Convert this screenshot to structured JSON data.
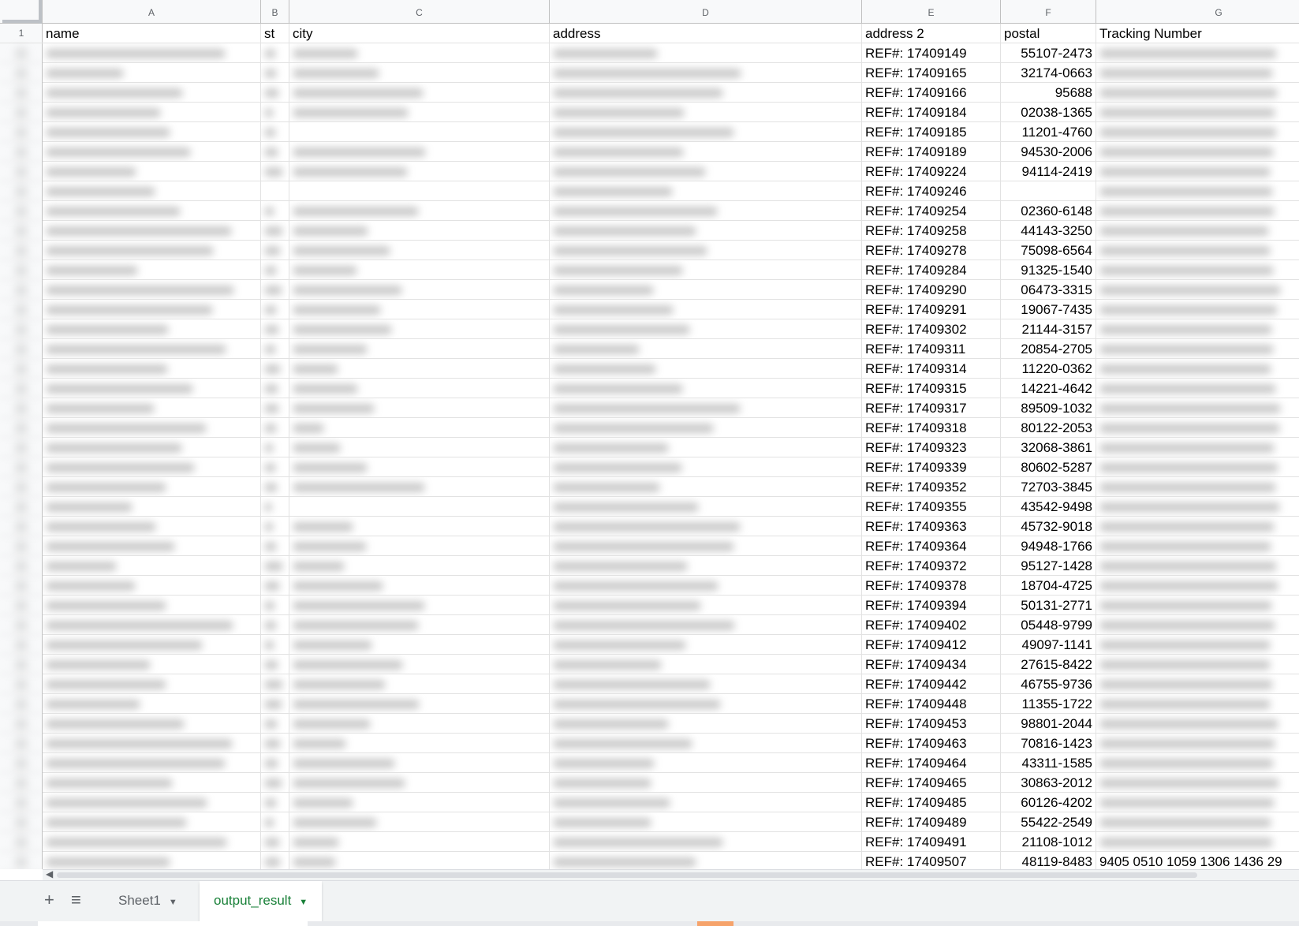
{
  "spreadsheet": {
    "column_letters": [
      "A",
      "B",
      "C",
      "D",
      "E",
      "F",
      "G"
    ],
    "header_row": {
      "row_number": "1",
      "labels": [
        "name",
        "st",
        "city",
        "address",
        "address 2",
        "postal",
        "Tracking Number"
      ]
    },
    "rows": [
      {
        "address2": "REF#: 17409149",
        "postal": "55107-2473"
      },
      {
        "address2": "REF#: 17409165",
        "postal": "32174-0663"
      },
      {
        "address2": "REF#: 17409166",
        "postal": "95688"
      },
      {
        "address2": "REF#: 17409184",
        "postal": "02038-1365"
      },
      {
        "address2": "REF#: 17409185",
        "postal": "11201-4760"
      },
      {
        "address2": "REF#: 17409189",
        "postal": "94530-2006"
      },
      {
        "address2": "REF#: 17409224",
        "postal": "94114-2419"
      },
      {
        "address2": "REF#: 17409246",
        "postal": ""
      },
      {
        "address2": "REF#: 17409254",
        "postal": "02360-6148"
      },
      {
        "address2": "REF#: 17409258",
        "postal": "44143-3250"
      },
      {
        "address2": "REF#: 17409278",
        "postal": "75098-6564"
      },
      {
        "address2": "REF#: 17409284",
        "postal": "91325-1540"
      },
      {
        "address2": "REF#: 17409290",
        "postal": "06473-3315"
      },
      {
        "address2": "REF#: 17409291",
        "postal": "19067-7435"
      },
      {
        "address2": "REF#: 17409302",
        "postal": "21144-3157"
      },
      {
        "address2": "REF#: 17409311",
        "postal": "20854-2705"
      },
      {
        "address2": "REF#: 17409314",
        "postal": "11220-0362"
      },
      {
        "address2": "REF#: 17409315",
        "postal": "14221-4642"
      },
      {
        "address2": "REF#: 17409317",
        "postal": "89509-1032"
      },
      {
        "address2": "REF#: 17409318",
        "postal": "80122-2053"
      },
      {
        "address2": "REF#: 17409323",
        "postal": "32068-3861"
      },
      {
        "address2": "REF#: 17409339",
        "postal": "80602-5287"
      },
      {
        "address2": "REF#: 17409352",
        "postal": "72703-3845"
      },
      {
        "address2": "REF#: 17409355",
        "postal": "43542-9498"
      },
      {
        "address2": "REF#: 17409363",
        "postal": "45732-9018"
      },
      {
        "address2": "REF#: 17409364",
        "postal": "94948-1766"
      },
      {
        "address2": "REF#: 17409372",
        "postal": "95127-1428"
      },
      {
        "address2": "REF#: 17409378",
        "postal": "18704-4725"
      },
      {
        "address2": "REF#: 17409394",
        "postal": "50131-2771"
      },
      {
        "address2": "REF#: 17409402",
        "postal": "05448-9799"
      },
      {
        "address2": "REF#: 17409412",
        "postal": "49097-1141"
      },
      {
        "address2": "REF#: 17409434",
        "postal": "27615-8422"
      },
      {
        "address2": "REF#: 17409442",
        "postal": "46755-9736"
      },
      {
        "address2": "REF#: 17409448",
        "postal": "11355-1722"
      },
      {
        "address2": "REF#: 17409453",
        "postal": "98801-2044"
      },
      {
        "address2": "REF#: 17409463",
        "postal": "70816-1423"
      },
      {
        "address2": "REF#: 17409464",
        "postal": "43311-1585"
      },
      {
        "address2": "REF#: 17409465",
        "postal": "30863-2012"
      },
      {
        "address2": "REF#: 17409485",
        "postal": "60126-4202"
      },
      {
        "address2": "REF#: 17409489",
        "postal": "55422-2549"
      },
      {
        "address2": "REF#:  17409491",
        "postal": "21108-1012"
      },
      {
        "address2": "REF#: 17409507",
        "postal": "48119-8483",
        "tracking": "9405 0510 1059 1306 1436 29"
      }
    ]
  },
  "sheet_tabs": {
    "add_icon": "+",
    "list_icon": "≡",
    "tabs": [
      {
        "label": "Sheet1",
        "active": false
      },
      {
        "label": "output_result",
        "active": true
      }
    ],
    "active_color": "#188038"
  },
  "colors": {
    "grid_line": "#e2e2e2",
    "header_bg": "#f8f9fa",
    "tab_bar_bg": "#f1f3f4"
  }
}
